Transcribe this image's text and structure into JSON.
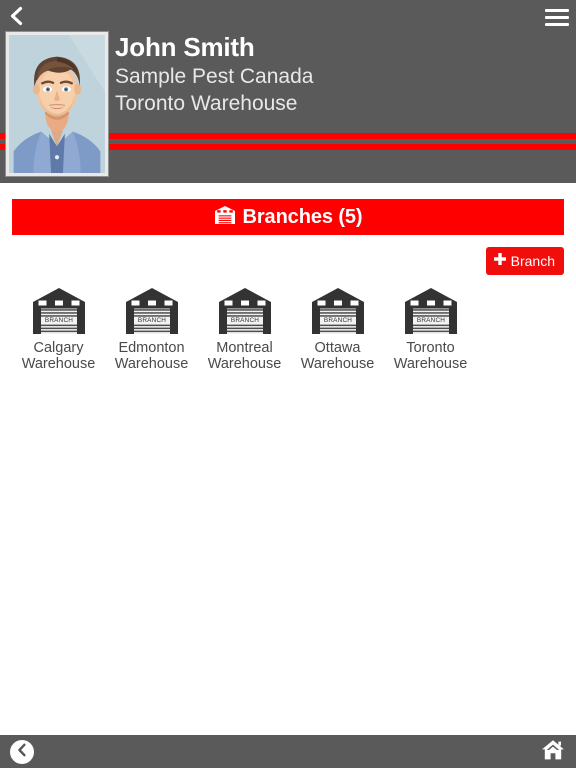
{
  "header": {
    "back_icon": "chevron-left-icon",
    "menu_icon": "hamburger-menu-icon",
    "avatar_alt": "user-avatar-portrait",
    "user_name": "John Smith",
    "company_name": "Sample Pest Canada",
    "location_name": "Toronto Warehouse",
    "background_color": "#5a5a5a",
    "stripe_color": "#ff0000"
  },
  "section": {
    "icon": "warehouse-icon",
    "title": "Branches (5)",
    "background_color": "#ff0000"
  },
  "add_button": {
    "icon": "plus-icon",
    "label": "Branch"
  },
  "branches": [
    {
      "name": "Calgary Warehouse",
      "icon_label": "BRANCH"
    },
    {
      "name": "Edmonton Warehouse",
      "icon_label": "BRANCH"
    },
    {
      "name": "Montreal Warehouse",
      "icon_label": "BRANCH"
    },
    {
      "name": "Ottawa Warehouse",
      "icon_label": "BRANCH"
    },
    {
      "name": "Toronto Warehouse",
      "icon_label": "BRANCH"
    }
  ],
  "footer": {
    "back_icon": "chevron-left-circle-icon",
    "home_icon": "home-icon",
    "background_color": "#5a5a5a"
  }
}
